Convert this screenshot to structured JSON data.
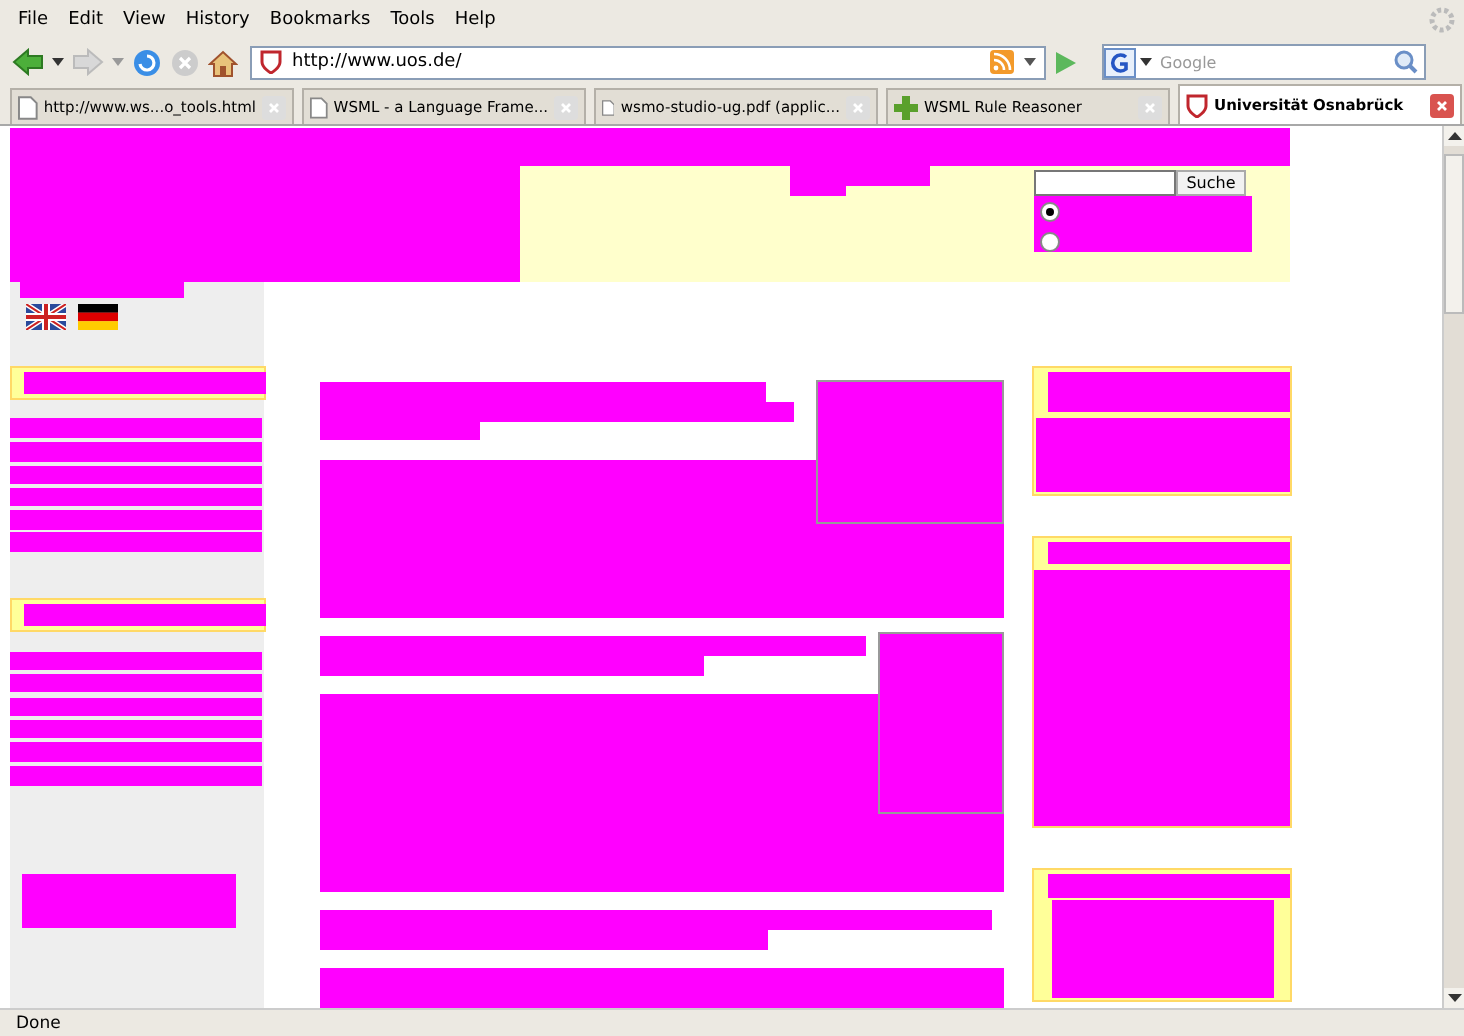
{
  "menu": [
    {
      "label": "File"
    },
    {
      "label": "Edit"
    },
    {
      "label": "View"
    },
    {
      "label": "History"
    },
    {
      "label": "Bookmarks"
    },
    {
      "label": "Tools"
    },
    {
      "label": "Help"
    }
  ],
  "address_bar": {
    "value": "http://www.uos.de/"
  },
  "search_bar": {
    "placeholder": "Google"
  },
  "tabs": [
    {
      "label": "http://www.ws...o_tools.html",
      "selected": false,
      "kind": "page"
    },
    {
      "label": "WSML - a Language Frame...",
      "selected": false,
      "kind": "page"
    },
    {
      "label": "wsmo-studio-ug.pdf (applic...",
      "selected": false,
      "kind": "page"
    },
    {
      "label": "WSML Rule Reasoner",
      "selected": false,
      "kind": "plugin"
    },
    {
      "label": "Universität Osnabrück",
      "selected": true,
      "kind": "site"
    }
  ],
  "page": {
    "search_button": "Suche",
    "search_scope": [
      {
        "selected": true
      },
      {
        "selected": false
      }
    ]
  },
  "status_bar": {
    "text": "Done"
  }
}
